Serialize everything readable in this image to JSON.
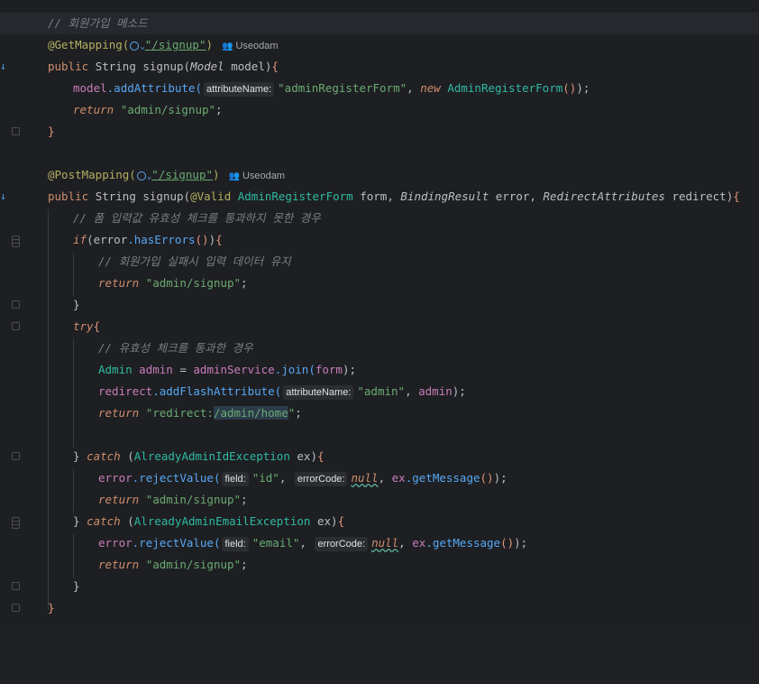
{
  "editor": {
    "lines": [
      {
        "highlight": true,
        "fold": false,
        "impl": false,
        "comment": "// 회원가입 메소드"
      },
      {
        "annotation": "@GetMapping(",
        "url": "\"/signup\"",
        "close": ")",
        "author": "Useodam"
      },
      {
        "signature": {
          "kw": "public",
          "type": "String",
          "name": "signup",
          "params": "(Model model)",
          "brace": "{"
        }
      },
      {
        "indent": 2,
        "obj": "model",
        "method": "addAttribute(",
        "hint": "attributeName:",
        "arg": "\"adminRegisterForm\"",
        "rest_kw": "new",
        "rest_cls": "AdminRegisterForm",
        "tail": "());"
      },
      {
        "indent": 2,
        "kw": "return",
        "str": "\"admin/signup\"",
        "tail": ";"
      },
      {
        "brace": "}"
      },
      {
        "blank": true
      },
      {
        "annotation": "@PostMapping(",
        "url": "\"/signup\"",
        "close": ")",
        "author": "Useodam"
      },
      {
        "signature2": {
          "kw": "public",
          "type": "String",
          "name": "signup",
          "params": "(@Valid AdminRegisterForm form, BindingResult error, RedirectAttributes redirect)",
          "brace": "{"
        }
      },
      {
        "indent": 2,
        "comment": "// 폼 입력값 유효성 체크를 통과하지 못한 경우"
      },
      {
        "indent": 2,
        "code": "if(error.hasErrors()){"
      },
      {
        "indent": 4,
        "comment": "// 회원가입 실패시 입력 데이터 유지"
      },
      {
        "indent": 4,
        "kw": "return",
        "str": "\"admin/signup\"",
        "tail": ";"
      },
      {
        "indent": 2,
        "brace": "}"
      },
      {
        "indent": 2,
        "code": "try{"
      },
      {
        "indent": 4,
        "comment": "// 유효성 체크를 통과한 경우"
      },
      {
        "indent": 4,
        "code": "Admin admin = adminService.join(form);"
      },
      {
        "indent": 4,
        "code": "redirect.addFlashAttribute(",
        "hint": "attributeName:",
        "arg": "\"admin\"",
        "tail": ", admin);"
      },
      {
        "indent": 4,
        "kw": "return",
        "str": "\"redirect:/admin/home\"",
        "tail": ";"
      },
      {
        "blank": true
      },
      {
        "indent": 2,
        "code": "} catch (AlreadyAdminIdException ex){"
      },
      {
        "indent": 4,
        "code": "error.rejectValue(",
        "hint1": "field:",
        "arg1": "\"id\",",
        "hint2": "errorCode:",
        "arg2": "null",
        "tail": ", ex.getMessage());"
      },
      {
        "indent": 4,
        "kw": "return",
        "str": "\"admin/signup\"",
        "tail": ";"
      },
      {
        "indent": 2,
        "code": "} catch (AlreadyAdminEmailException ex){"
      },
      {
        "indent": 4,
        "code": "error.rejectValue(",
        "hint1": "field:",
        "arg1": "\"email\",",
        "hint2": "errorCode:",
        "arg2": "null",
        "tail": ", ex.getMessage());"
      },
      {
        "indent": 4,
        "kw": "return",
        "str": "\"admin/signup\"",
        "tail": ";"
      },
      {
        "indent": 2,
        "brace": "}"
      },
      {
        "brace": "}"
      }
    ]
  },
  "text": {
    "l0": "// 회원가입 메소드",
    "l1_ann": "@GetMapping(",
    "l1_url": "\"/signup\"",
    "l1_close": ")",
    "l1_author": "Useodam",
    "l2_kw": "public",
    "l2_type": "String",
    "l2_name": "signup(",
    "l2_ptype": "Model",
    "l2_pname": "model",
    "l2_close": ")",
    "l2_brace": "{",
    "l3_obj": "model",
    "l3_method": ".addAttribute(",
    "l3_hint": "attributeName:",
    "l3_arg": "\"adminRegisterForm\"",
    "l3_comma": ", ",
    "l3_new": "new",
    "l3_cls": "AdminRegisterForm",
    "l3_paren": "()",
    "l3_tail": ");",
    "ret": "return",
    "signup_str": "\"admin/signup\"",
    "semi": ";",
    "close_brace": "}",
    "l7_ann": "@PostMapping(",
    "l7_url": "\"/signup\"",
    "l7_close": ")",
    "l7_author": "Useodam",
    "l8_valid": "@Valid",
    "l8_cls1": "AdminRegisterForm",
    "l8_p1": "form",
    "l8_cls2": "BindingResult",
    "l8_p2": "error",
    "l8_cls3": "RedirectAttributes",
    "l8_p3": "redirect",
    "l9": "// 폼 입력값 유효성 체크를 통과하지 못한 경우",
    "l10_if": "if",
    "l10_err": "error",
    "l10_m": ".hasErrors",
    "l11": "// 회원가입 실패시 입력 데이터 유지",
    "l14_try": "try",
    "l15": "// 유효성 체크를 통과한 경우",
    "l16_cls": "Admin",
    "l16_var": "admin",
    "l16_eq": " = ",
    "l16_svc": "adminService",
    "l16_m": ".join(",
    "l16_arg": "form",
    "l16_tail": ");",
    "l17_obj": "redirect",
    "l17_m": ".addFlashAttribute(",
    "l17_hint": "attributeName:",
    "l17_arg": "\"admin\"",
    "l17_var": "admin",
    "l17_tail": ");",
    "l18_str_a": "\"redirect:",
    "l18_str_b": "/admin/home",
    "l18_str_c": "\"",
    "catch": "catch",
    "l20_ex": "AlreadyAdminIdException",
    "ex": "ex",
    "l23_ex": "AlreadyAdminEmailException",
    "err": "error",
    "reject": ".rejectValue(",
    "hint_field": "field:",
    "id_str": "\"id\"",
    "email_str": "\"email\"",
    "hint_code": "errorCode:",
    "null": "null",
    "getmsg": ".getMessage",
    "tail2": ");"
  },
  "colors": {
    "background": "#1e1f22",
    "keyword": "#cf8e6d",
    "string": "#6aab73",
    "annotation": "#b3ae60",
    "comment": "#7a7e85",
    "method": "#56a8f5",
    "field": "#c77dbb",
    "class": "#2fbaa3"
  }
}
